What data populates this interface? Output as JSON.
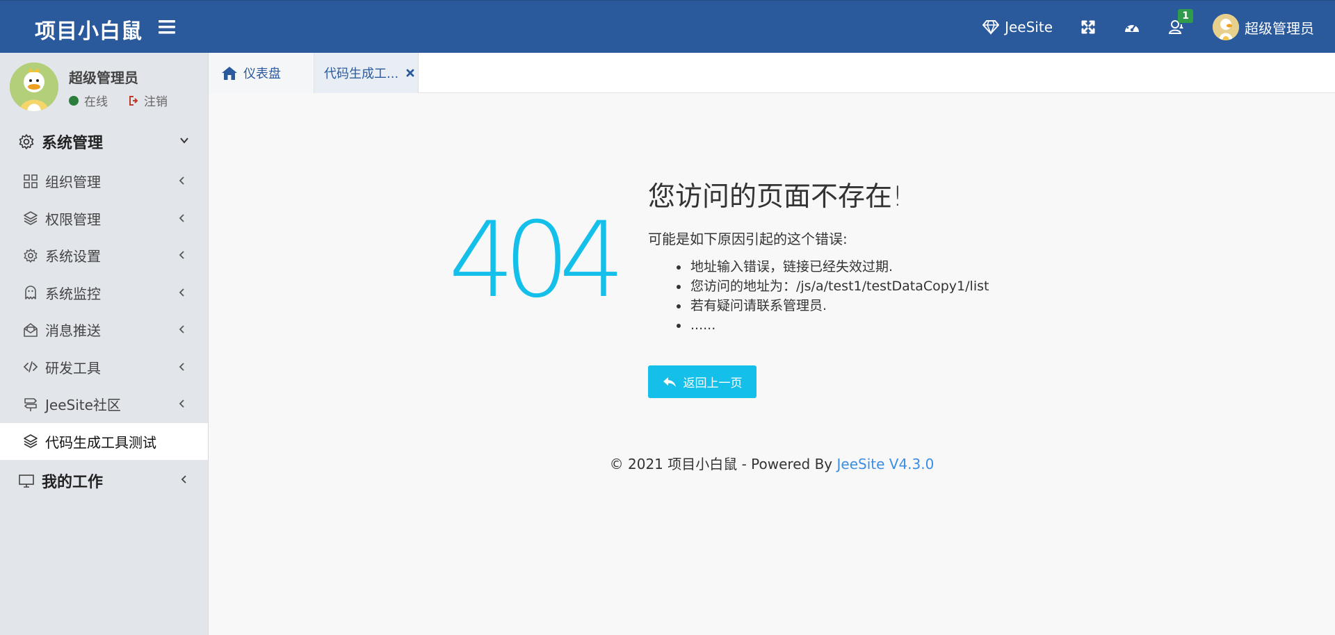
{
  "header": {
    "brand": "项目小白鼠",
    "jeesite_label": "JeeSite",
    "notification_count": "1",
    "user_name": "超级管理员"
  },
  "sidebar": {
    "user": {
      "name": "超级管理员",
      "status": "在线",
      "logout": "注销"
    },
    "group_system": "系统管理",
    "items": [
      {
        "label": "组织管理",
        "icon": "grid-icon"
      },
      {
        "label": "权限管理",
        "icon": "layers-icon"
      },
      {
        "label": "系统设置",
        "icon": "gear-icon"
      },
      {
        "label": "系统监控",
        "icon": "ghost-icon"
      },
      {
        "label": "消息推送",
        "icon": "envelope-open-icon"
      },
      {
        "label": "研发工具",
        "icon": "code-icon"
      },
      {
        "label": "JeeSite社区",
        "icon": "signpost-icon"
      },
      {
        "label": "代码生成工具测试",
        "icon": "layers-icon"
      }
    ],
    "group_work": "我的工作"
  },
  "tabs": {
    "dashboard": "仪表盘",
    "code_gen": "代码生成工..."
  },
  "error": {
    "code": "404",
    "title": "您访问的页面不存在!",
    "desc": "可能是如下原因引起的这个错误:",
    "reasons": [
      "地址输入错误，链接已经失效过期.",
      "您访问的地址为：/js/a/test1/testDataCopy1/list",
      "若有疑问请联系管理员.",
      "......"
    ],
    "back_button": "返回上一页"
  },
  "footer": {
    "text": "© 2021 项目小白鼠 - Powered By ",
    "link": "JeeSite V4.3.0"
  },
  "colors": {
    "header_bg": "#2b5a9c",
    "accent": "#14c0ea",
    "link": "#3a8ee6",
    "online": "#2a7d3b",
    "badge": "#2e9c4a"
  }
}
